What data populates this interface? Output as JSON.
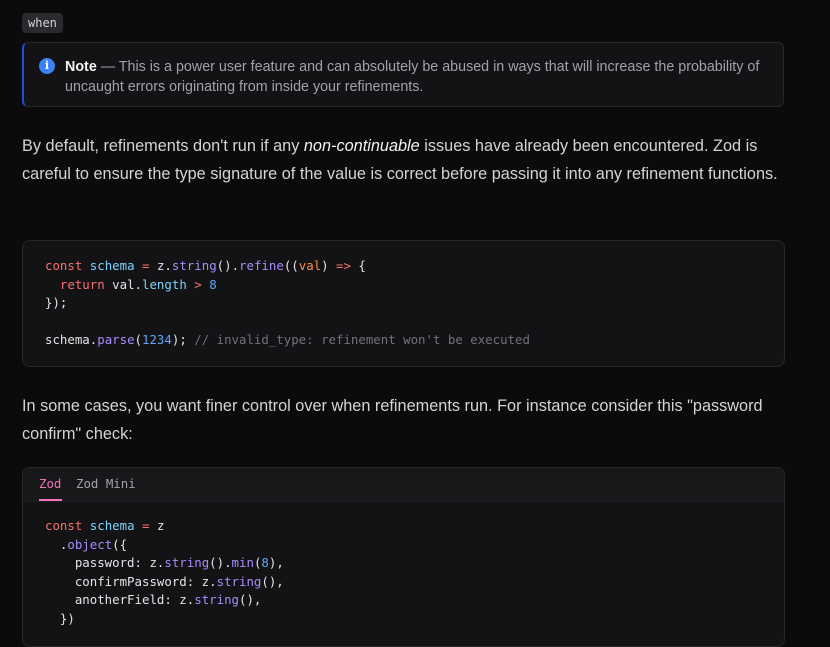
{
  "chip": {
    "text": "when"
  },
  "note": {
    "label": "Note",
    "dash": " — ",
    "text": "This is a power user feature and can absolutely be abused in ways that will increase the probability of uncaught errors originating from inside your refinements."
  },
  "para1": {
    "before": "By default, refinements don't run if any ",
    "emphasis": "non-continuable",
    "after": " issues have already been encountered. Zod is careful to ensure the type signature of the value is correct before passing it into any refinement functions."
  },
  "code1": {
    "l1": {
      "kw": "const",
      "id": "schema",
      "op": "=",
      "obj": "z",
      "f1": "string",
      "f2": "refine",
      "arg": "val",
      "arrow": "=>"
    },
    "l2": {
      "kw": "return",
      "obj": "val",
      "prop": "length",
      "op": ">",
      "num": "8"
    },
    "l3": "});",
    "l5": {
      "obj": "schema",
      "fn": "parse",
      "num": "1234",
      "comment": "// invalid_type: refinement won't be executed"
    }
  },
  "para2": {
    "text": "In some cases, you want finer control over when refinements run. For instance consider this \"password confirm\" check:"
  },
  "tabs": [
    "Zod",
    "Zod Mini"
  ],
  "code2": {
    "l1": {
      "kw": "const",
      "id": "schema",
      "op": "=",
      "obj": "z"
    },
    "l2": {
      "fn": "object"
    },
    "l3": {
      "key": "password",
      "obj": "z",
      "f1": "string",
      "f2": "min",
      "num": "8"
    },
    "l4": {
      "key": "confirmPassword",
      "obj": "z",
      "f1": "string"
    },
    "l5": {
      "key": "anotherField",
      "obj": "z",
      "f1": "string"
    },
    "l6": "})"
  }
}
